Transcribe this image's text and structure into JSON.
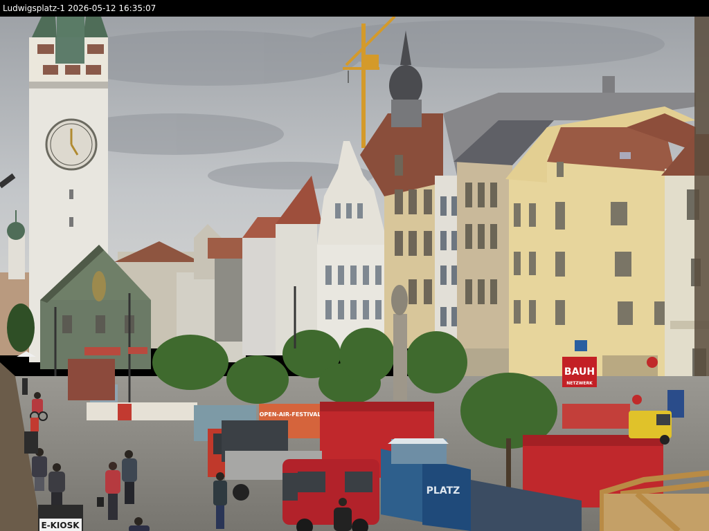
{
  "caption": {
    "location": "Ludwigsplatz-1",
    "datetime": "2026-05-12 16:35:07"
  },
  "signs": {
    "kiosk": "E-KIOSK",
    "bauhaus": "BAUH",
    "bauhaus_sub": "NETZWERK",
    "banner": "OPEN-AIR-FESTIVAL",
    "hoarding": "PLATZ"
  },
  "colors": {
    "sky": "#b8bcc0",
    "tower": "#e8e6df",
    "tower_roof": "#4f6d58",
    "yellow_facade": "#e7d59c",
    "container_red": "#c0282c",
    "van_red": "#b2222a",
    "tree_green": "#3f6a2e",
    "cobble": "#8f8d88"
  }
}
